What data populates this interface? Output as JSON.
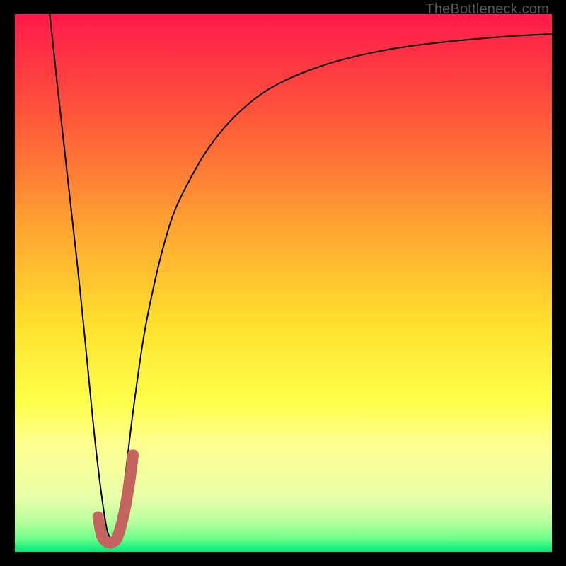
{
  "watermark": "TheBottleneck.com",
  "chart_data": {
    "type": "line",
    "title": "",
    "xlabel": "",
    "ylabel": "",
    "xlim": [
      0,
      100
    ],
    "ylim": [
      0,
      100
    ],
    "grid": false,
    "legend": false,
    "background_gradient": {
      "stops": [
        {
          "offset": 0.0,
          "color": "#ff1a4b"
        },
        {
          "offset": 0.2,
          "color": "#ff5a3a"
        },
        {
          "offset": 0.4,
          "color": "#ffa531"
        },
        {
          "offset": 0.58,
          "color": "#ffe22e"
        },
        {
          "offset": 0.72,
          "color": "#ffff4a"
        },
        {
          "offset": 0.8,
          "color": "#ffff90"
        },
        {
          "offset": 0.9,
          "color": "#e8ffa8"
        },
        {
          "offset": 0.945,
          "color": "#b7ff9e"
        },
        {
          "offset": 0.975,
          "color": "#6dff8a"
        },
        {
          "offset": 1.0,
          "color": "#00e87a"
        }
      ]
    },
    "series": [
      {
        "name": "bottleneck-curve",
        "stroke": "#000000",
        "stroke_width": 2.0,
        "x": [
          6.5,
          8,
          10,
          12,
          13.5,
          15,
          16.5,
          17.5,
          18.5,
          20,
          22,
          24,
          26,
          28,
          30,
          33,
          36,
          40,
          45,
          50,
          56,
          62,
          70,
          78,
          86,
          94,
          100
        ],
        "y": [
          100,
          86,
          68,
          50,
          35,
          20,
          8,
          3,
          3,
          10,
          26,
          40,
          50,
          58,
          64,
          70,
          75,
          80,
          84.5,
          87.5,
          90,
          91.8,
          93.5,
          94.6,
          95.4,
          96,
          96.3
        ]
      },
      {
        "name": "highlight-j",
        "stroke": "#c4645f",
        "stroke_width": 16,
        "linecap": "round",
        "x": [
          15.5,
          16.2,
          17.2,
          18.2,
          19.2,
          20.5,
          21.5,
          22.0
        ],
        "y": [
          6.5,
          3.0,
          1.8,
          1.8,
          3.0,
          8.0,
          14.0,
          18.0
        ]
      }
    ]
  }
}
